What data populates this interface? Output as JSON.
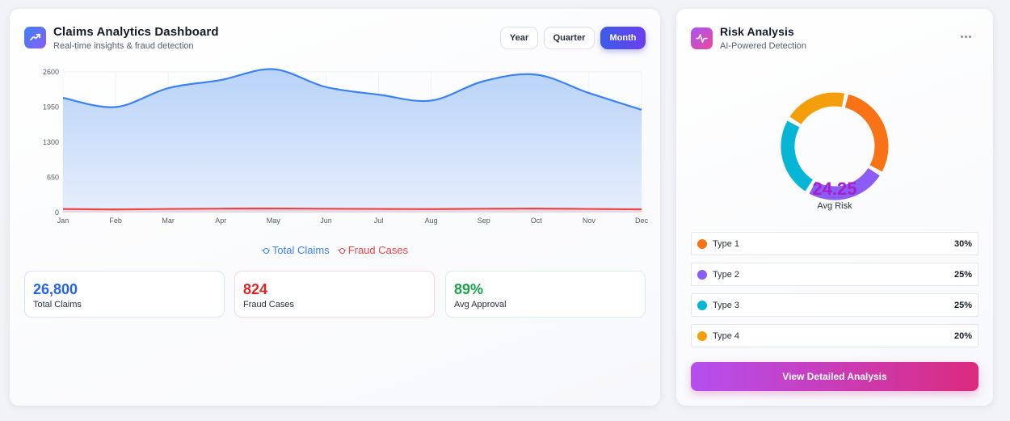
{
  "dashboard": {
    "title": "Claims Analytics Dashboard",
    "subtitle": "Real-time insights & fraud detection",
    "icon": "trending-up-icon",
    "accent": "#4f46e5",
    "period_buttons": [
      {
        "label": "Year",
        "active": false
      },
      {
        "label": "Quarter",
        "active": false
      },
      {
        "label": "Month",
        "active": true
      }
    ]
  },
  "chart_data": {
    "type": "area",
    "categories": [
      "Jan",
      "Feb",
      "Mar",
      "Apr",
      "May",
      "Jun",
      "Jul",
      "Aug",
      "Sep",
      "Oct",
      "Nov",
      "Dec"
    ],
    "series": [
      {
        "name": "Total Claims",
        "values": [
          2120,
          1950,
          2300,
          2450,
          2650,
          2320,
          2180,
          2070,
          2430,
          2550,
          2210,
          1900
        ],
        "color": "#3b82f6"
      },
      {
        "name": "Fraud Cases",
        "values": [
          65,
          58,
          66,
          72,
          75,
          70,
          66,
          64,
          70,
          73,
          66,
          60
        ],
        "color": "#ef4444"
      }
    ],
    "yticks": [
      0,
      650,
      1300,
      1950,
      2600
    ],
    "ylim": [
      0,
      2600
    ],
    "title": "",
    "xlabel": "",
    "ylabel": "",
    "grid": true,
    "legend": "bottom-center"
  },
  "stats": [
    {
      "value": "26,800",
      "label": "Total Claims",
      "color": "#2563eb",
      "border": "#d6e3f8"
    },
    {
      "value": "824",
      "label": "Fraud Cases",
      "color": "#dc2626",
      "border": "#f6d6da"
    },
    {
      "value": "89%",
      "label": "Avg Approval",
      "color": "#16a34a",
      "border": "#d4f2e0"
    }
  ],
  "risk": {
    "title": "Risk Analysis",
    "subtitle": "AI-Powered Detection",
    "icon": "activity-pulse-icon",
    "more_icon": "more-horizontal-icon",
    "avg_value": "24.25",
    "avg_label": "Avg Risk",
    "types": [
      {
        "label": "Type 1",
        "percent": "30%",
        "value": 30,
        "color": "#f97316"
      },
      {
        "label": "Type 2",
        "percent": "25%",
        "value": 25,
        "color": "#8b5cf6"
      },
      {
        "label": "Type 3",
        "percent": "25%",
        "value": 25,
        "color": "#06b6d4"
      },
      {
        "label": "Type 4",
        "percent": "20%",
        "value": 20,
        "color": "#f59e0b"
      }
    ],
    "cta_label": "View Detailed Analysis"
  }
}
